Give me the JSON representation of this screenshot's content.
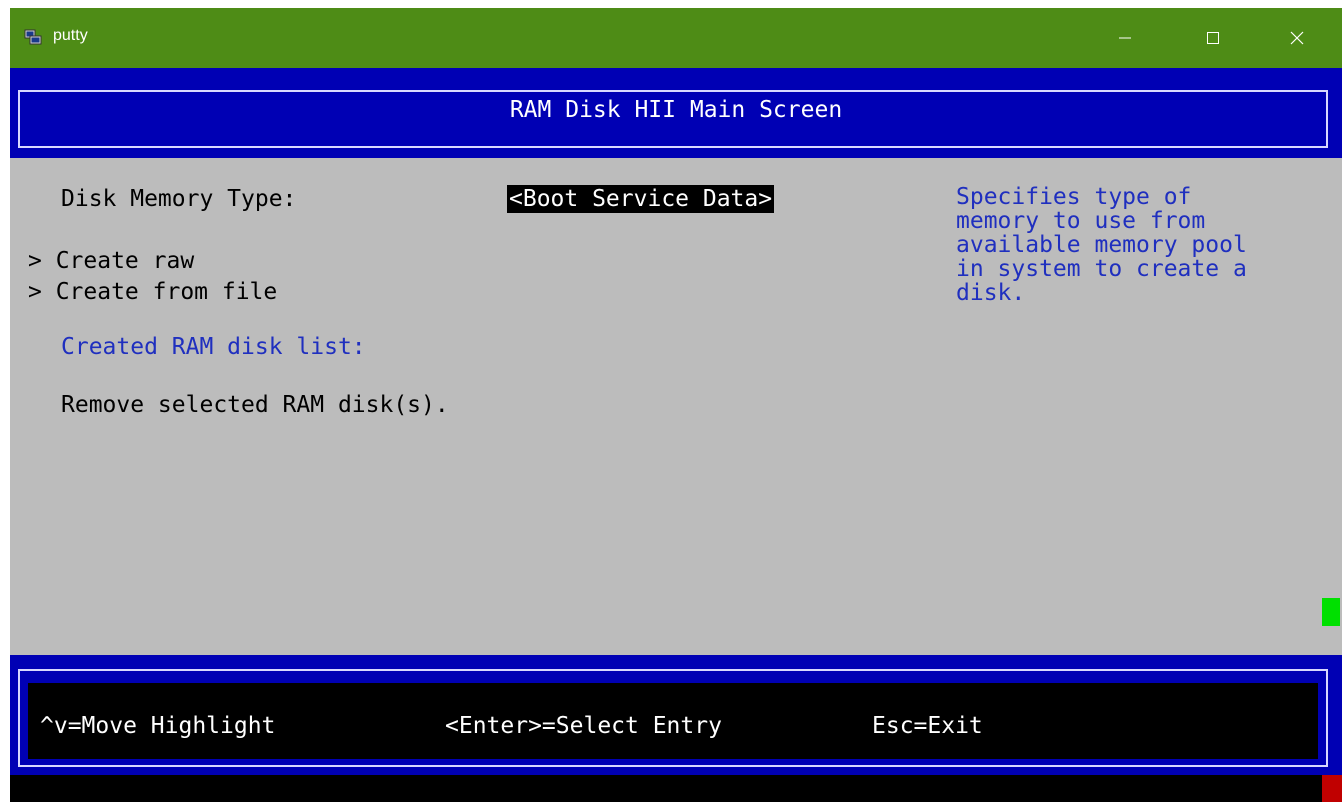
{
  "window": {
    "title": "putty",
    "titlebar_color": "#4e8c16"
  },
  "terminal": {
    "header_title": "RAM Disk HII Main Screen",
    "disk_memory_label": "Disk Memory Type:",
    "disk_memory_value": "<Boot Service Data>",
    "menu": [
      {
        "label": "> Create raw"
      },
      {
        "label": "> Create from file"
      }
    ],
    "created_list_label": "Created RAM disk list:",
    "remove_label": "Remove selected RAM disk(s).",
    "help_text": "Specifies type of\nmemory to use from\navailable memory pool\nin system to create a\ndisk.",
    "footer": {
      "move": "^v=Move Highlight",
      "select": "<Enter>=Select Entry",
      "exit": "Esc=Exit"
    },
    "colors": {
      "header_bg": "#0000b4",
      "body_bg": "#bcbcbc",
      "help_text": "#1f2fbf"
    }
  },
  "icons": {
    "app": "putty-icon",
    "minimize": "minimize-icon",
    "maximize": "maximize-icon",
    "close": "close-icon"
  }
}
